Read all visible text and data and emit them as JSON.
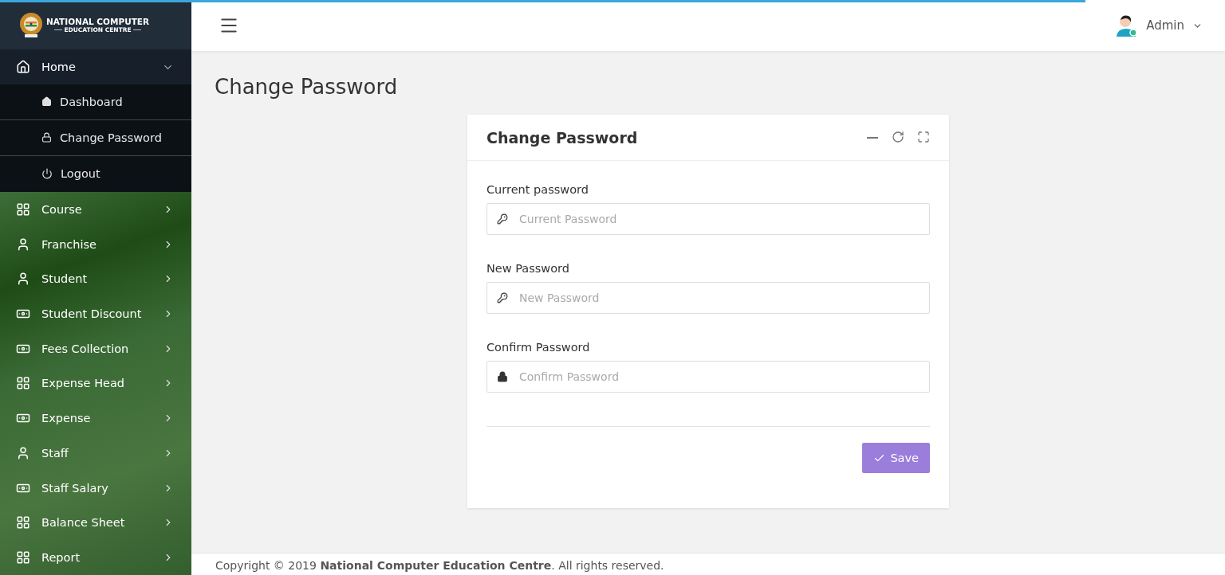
{
  "loading_bar": {
    "level": 0.886
  },
  "brand": {
    "line_1": "NATIONAL COMPUTER",
    "line_2": "EDUCATION CENTRE"
  },
  "sidebar": {
    "items": [
      {
        "label": "Home",
        "kind": "house",
        "expanded": true,
        "children": [
          {
            "label": "Dashboard",
            "kind": "house"
          },
          {
            "label": "Change Password",
            "kind": "lock"
          },
          {
            "label": "Logout",
            "kind": "power"
          }
        ]
      },
      {
        "label": "Course",
        "kind": "grid",
        "expanded": false
      },
      {
        "label": "Franchise",
        "kind": "user",
        "expanded": false
      },
      {
        "label": "Student",
        "kind": "user",
        "expanded": false
      },
      {
        "label": "Student Discount",
        "kind": "money",
        "expanded": false
      },
      {
        "label": "Fees Collection",
        "kind": "money",
        "expanded": false
      },
      {
        "label": "Expense Head",
        "kind": "grid",
        "expanded": false
      },
      {
        "label": "Expense",
        "kind": "money",
        "expanded": false
      },
      {
        "label": "Staff",
        "kind": "user",
        "expanded": false
      },
      {
        "label": "Staff Salary",
        "kind": "money",
        "expanded": false
      },
      {
        "label": "Balance Sheet",
        "kind": "grid",
        "expanded": false
      },
      {
        "label": "Report",
        "kind": "grid",
        "expanded": false
      }
    ]
  },
  "header": {
    "user": "Admin"
  },
  "page_title": "Change Password",
  "card": {
    "title": "Change Password",
    "fields": [
      {
        "label": "Current password",
        "placeholder": "Current Password",
        "kind": "key"
      },
      {
        "label": "New Password",
        "placeholder": "New Password",
        "kind": "key"
      },
      {
        "label": "Confirm Password",
        "placeholder": "Confirm Password",
        "kind": "lock"
      }
    ],
    "button": "Save"
  },
  "footer": "Copyright © 2019 **National Computer Education Centre**. All rights reserved."
}
